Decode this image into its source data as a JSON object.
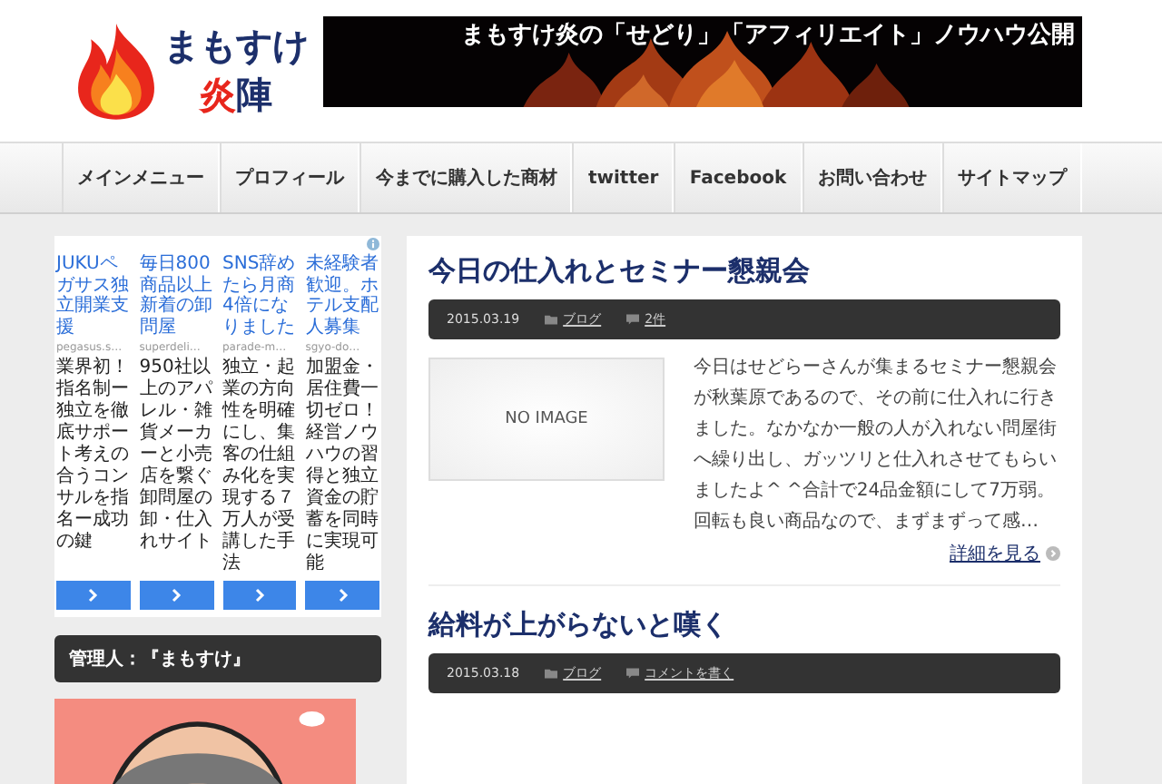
{
  "header": {
    "logo_name": "まもすけ",
    "logo_sub": [
      {
        "text": "炎",
        "color": "#e8261c"
      },
      {
        "text": "陣",
        "color": "#1c2f6b"
      }
    ],
    "banner_text": "まもすけ炎の「せどり」「アフィリエイト」ノウハウ公開"
  },
  "nav": [
    "メインメニュー",
    "プロフィール",
    "今までに購入した商材",
    "twitter",
    "Facebook",
    "お問い合わせ",
    "サイトマップ"
  ],
  "ads": [
    {
      "title": "JUKUペガサス独立開業支援",
      "source": "pegasus.s…",
      "text": "業界初！指名制ー独立を徹底サポート考えの合うコンサルを指名ー成功の鍵"
    },
    {
      "title": "毎日800商品以上新着の卸問屋",
      "source": "superdeli…",
      "text": "950社以上のアパレル・雑貨メーカーと小売店を繋ぐ卸問屋の卸・仕入れサイト"
    },
    {
      "title": "SNS辞めたら月商4倍になりました",
      "source": "parade-m…",
      "text": "独立・起業の方向性を明確にし、集客の仕組み化を実現する７万人が受講した手法"
    },
    {
      "title": "未経験者歓迎。ホテル支配人募集",
      "source": "sgyo-do…",
      "text": "加盟金・居住費一切ゼロ！経営ノウハウの習得と独立資金の貯蓄を同時に実現可能"
    }
  ],
  "sidebar": {
    "widget_title": "管理人：『まもすけ』"
  },
  "posts": [
    {
      "title": "今日の仕入れとセミナー懇親会",
      "date": "2015.03.19",
      "category": "ブログ",
      "comments": "2件",
      "thumbnail": "NO IMAGE",
      "excerpt": "今日はせどらーさんが集まるセミナー懇親会が秋葉原であるので、その前に仕入れに行きました。なかなか一般の人が入れない問屋街へ繰り出し、ガッツリと仕入れさせてもらいましたよ^ ^合計で24品金額にして7万弱。回転も良い商品なので、まずまずって感…",
      "more": "詳細を見る"
    },
    {
      "title": "給料が上がらないと嘆く",
      "date": "2015.03.18",
      "category": "ブログ",
      "comments": "コメントを書く"
    }
  ]
}
